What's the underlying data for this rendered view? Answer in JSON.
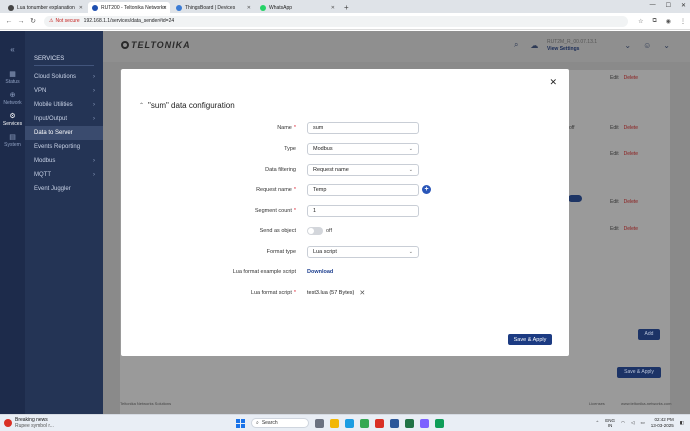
{
  "browser": {
    "tabs": [
      {
        "label": "Lua tonumber explanation",
        "color": "#444"
      },
      {
        "label": "RUT200 - Teltonika Networks",
        "color": "#1e4fb0"
      },
      {
        "label": "ThingsBoard | Devices",
        "color": "#3a7bd5"
      },
      {
        "label": "WhatsApp",
        "color": "#25d366"
      }
    ],
    "new_tab": "+",
    "not_secure": "Not secure",
    "url": "192.168.1.1/services/data_sender#id=24"
  },
  "sidebar": {
    "items": [
      {
        "label": "Status",
        "icon": "status-icon"
      },
      {
        "label": "Network",
        "icon": "network-icon"
      },
      {
        "label": "Services",
        "icon": "services-icon"
      },
      {
        "label": "System",
        "icon": "system-icon"
      }
    ]
  },
  "submenu": {
    "title": "SERVICES",
    "items": [
      {
        "label": "Cloud Solutions"
      },
      {
        "label": "VPN"
      },
      {
        "label": "Mobile Utilities"
      },
      {
        "label": "Input/Output"
      },
      {
        "label": "Data to Server"
      },
      {
        "label": "Events Reporting"
      },
      {
        "label": "Modbus"
      },
      {
        "label": "MQTT"
      },
      {
        "label": "Event Juggler"
      }
    ]
  },
  "topbar": {
    "logo": "TELTONIKA",
    "device_model": "RUT2M_R_00.07.13.1",
    "view_settings": "View Settings"
  },
  "background": {
    "edit": "Edit",
    "delete": "Delete",
    "off": "off",
    "add": "Add",
    "save_apply": "Save & Apply",
    "footer_left": "Teltonika Networks Solutions",
    "footer_licenses": "Licenses",
    "footer_url": "www.teltonika-networks.com"
  },
  "modal": {
    "title": "\"sum\" data configuration",
    "fields": {
      "name": {
        "label": "Name",
        "value": "sum"
      },
      "type": {
        "label": "Type",
        "value": "Modbus"
      },
      "data_filtering": {
        "label": "Data filtering",
        "value": "Request name"
      },
      "request_name": {
        "label": "Request name",
        "value": "Temp"
      },
      "segment_count": {
        "label": "Segment count",
        "value": "1"
      },
      "send_as_object": {
        "label": "Send as object",
        "value": "off"
      },
      "format_type": {
        "label": "Format type",
        "value": "Lua script"
      },
      "lua_example": {
        "label": "Lua format example script",
        "value": "Download"
      },
      "lua_script": {
        "label": "Lua format script",
        "value": "test3.lua (57 Bytes)"
      }
    },
    "save_apply": "Save & Apply"
  },
  "taskbar": {
    "news_title": "Breaking news",
    "news_sub": "Rupee symbol r...",
    "search": "Search",
    "lang_top": "ENG",
    "lang_bottom": "IN",
    "time": "02:42 PM",
    "date": "13-03-2025"
  }
}
